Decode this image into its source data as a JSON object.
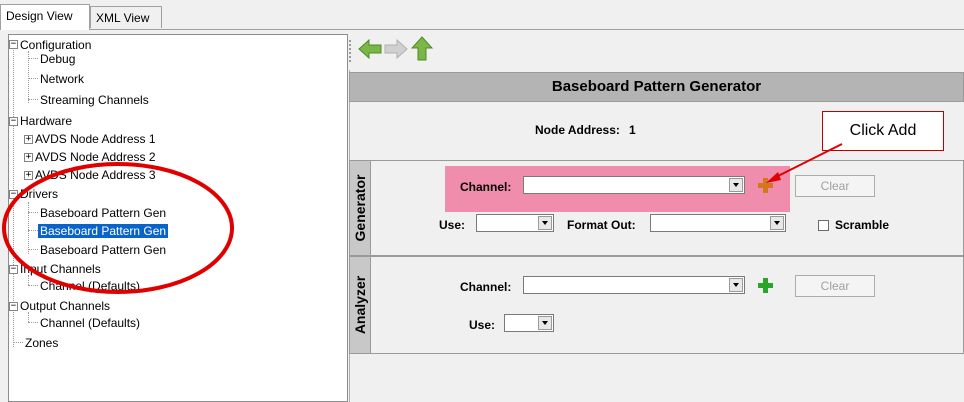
{
  "tabs": [
    {
      "label": "Design View"
    },
    {
      "label": "XML View"
    }
  ],
  "tree": {
    "configuration": {
      "label": "Configuration",
      "children": [
        "Debug",
        "Network",
        "Streaming Channels"
      ]
    },
    "hardware": {
      "label": "Hardware",
      "children": [
        "AVDS Node Address 1",
        "AVDS Node Address 2",
        "AVDS Node Address 3"
      ]
    },
    "drivers": {
      "label": "Drivers",
      "children": [
        "Baseboard Pattern Gen",
        "Baseboard Pattern Gen",
        "Baseboard Pattern Gen"
      ],
      "selected_index": 1
    },
    "input_channels": {
      "label": "Input Channels",
      "children": [
        "Channel  (Defaults)"
      ]
    },
    "output_channels": {
      "label": "Output Channels",
      "children": [
        "Channel  (Defaults)"
      ]
    },
    "zones": {
      "label": "Zones"
    }
  },
  "header": {
    "title": "Baseboard Pattern Generator"
  },
  "node_address": {
    "label": "Node Address:",
    "value": "1"
  },
  "generator": {
    "section_label": "Generator",
    "channel_label": "Channel:",
    "channel_value": "",
    "clear_label": "Clear",
    "use_label": "Use:",
    "use_value": "",
    "format_label": "Format Out:",
    "format_value": "",
    "scramble_label": "Scramble",
    "add_color": "#d2781e"
  },
  "analyzer": {
    "section_label": "Analyzer",
    "channel_label": "Channel:",
    "channel_value": "",
    "clear_label": "Clear",
    "use_label": "Use:",
    "use_value": "",
    "add_color": "#2aa52a"
  },
  "annotation": {
    "text": "Click Add",
    "color": "#e00000",
    "highlight_color": "#f07aa0"
  }
}
